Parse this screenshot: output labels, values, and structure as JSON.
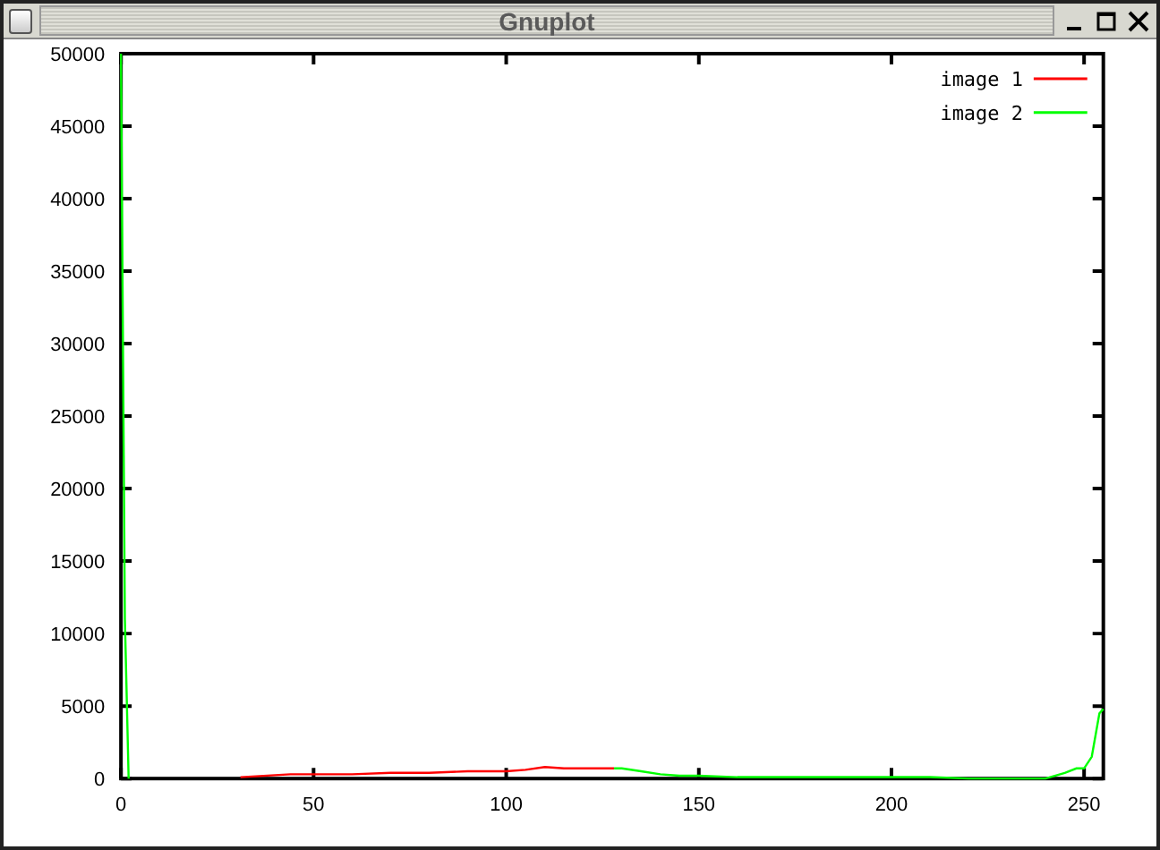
{
  "window": {
    "title": "Gnuplot"
  },
  "chart_data": {
    "type": "line",
    "legend": "top right",
    "x": [
      0,
      1,
      2,
      31,
      44,
      50,
      60,
      70,
      80,
      90,
      100,
      105,
      110,
      115,
      120,
      128,
      130,
      135,
      140,
      145,
      150,
      160,
      170,
      180,
      190,
      200,
      210,
      220,
      240,
      245,
      248,
      250,
      252,
      254,
      255
    ],
    "series": [
      {
        "name": "image 1",
        "color": "#ff0000",
        "values": [
          null,
          null,
          null,
          100,
          300,
          300,
          300,
          400,
          400,
          500,
          500,
          600,
          800,
          700,
          700,
          700,
          null,
          null,
          null,
          null,
          null,
          null,
          null,
          null,
          null,
          null,
          null,
          null,
          null,
          null,
          null,
          null,
          null,
          null,
          null
        ]
      },
      {
        "name": "image 2",
        "color": "#00ff00",
        "values": [
          50000,
          11000,
          0,
          null,
          null,
          null,
          null,
          null,
          null,
          null,
          null,
          null,
          null,
          null,
          null,
          700,
          700,
          500,
          300,
          200,
          200,
          100,
          100,
          100,
          100,
          100,
          100,
          0,
          0,
          400,
          700,
          700,
          1500,
          4500,
          4800
        ]
      }
    ],
    "xlim": [
      0,
      255
    ],
    "ylim": [
      0,
      50000
    ],
    "xticks": [
      0,
      50,
      100,
      150,
      200,
      250
    ],
    "yticks": [
      0,
      5000,
      10000,
      15000,
      20000,
      25000,
      30000,
      35000,
      40000,
      45000,
      50000
    ]
  }
}
